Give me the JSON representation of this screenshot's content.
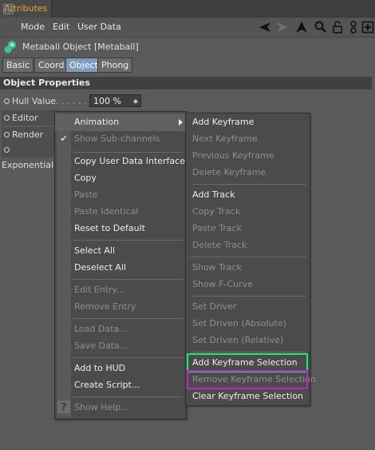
{
  "tab": {
    "label": "Attributes"
  },
  "menubar": {
    "items": [
      "Mode",
      "Edit",
      "User Data"
    ]
  },
  "object": {
    "title": "Metaball Object [Metaball]"
  },
  "subtabs": [
    "Basic",
    "Coord.",
    "Object",
    "Phong"
  ],
  "section": {
    "title": "Object Properties"
  },
  "properties": [
    {
      "label": "Hull Value",
      "dots": ". . . . . . . .",
      "value": "100 %"
    },
    {
      "label": "Editor Subd"
    },
    {
      "label": "Render Sub"
    },
    {
      "label": "Exponential"
    }
  ],
  "context_menu": {
    "animation": "Animation",
    "show_subchannels": "Show Sub-channels",
    "copy_udi": "Copy User Data Interface",
    "copy": "Copy",
    "paste": "Paste",
    "paste_identical": "Paste Identical",
    "reset_default": "Reset to Default",
    "select_all": "Select All",
    "deselect_all": "Deselect All",
    "edit_entry": "Edit Entry...",
    "remove_entry": "Remove Entry",
    "load_data": "Load Data...",
    "save_data": "Save Data...",
    "add_to_hud": "Add to HUD",
    "create_script": "Create Script...",
    "show_help": "Show Help..."
  },
  "submenu": {
    "add_keyframe": "Add Keyframe",
    "next_keyframe": "Next Keyframe",
    "previous_keyframe": "Previous Keyframe",
    "delete_keyframe": "Delete Keyframe",
    "add_track": "Add Track",
    "copy_track": "Copy Track",
    "paste_track": "Paste Track",
    "delete_track": "Delete Track",
    "show_track": "Show Track",
    "show_fcurve": "Show F-Curve",
    "set_driver": "Set Driver",
    "set_driven_abs": "Set Driven (Absolute)",
    "set_driven_rel": "Set Driven (Relative)",
    "add_keyframe_selection": "Add Keyframe Selection",
    "remove_keyframe_selection": "Remove Keyframe Selection",
    "clear_keyframe_selection": "Clear Keyframe Selection"
  },
  "colors": {
    "tab_text": "#f0a030",
    "highlight_green": "#1ee870",
    "highlight_purple": "#c21ecf",
    "active_subtab": "#7e9cc0"
  }
}
